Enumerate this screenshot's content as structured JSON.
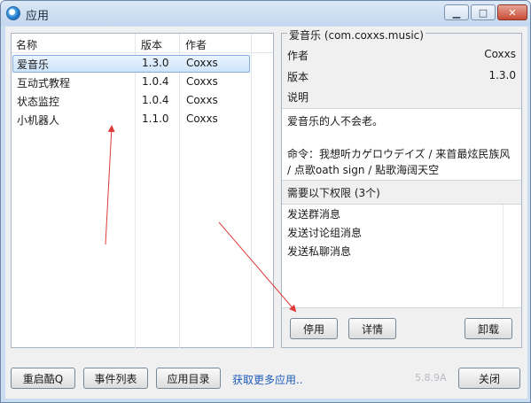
{
  "window": {
    "title": "应用",
    "icon": "app-icon",
    "controls": [
      "minimize",
      "maximize",
      "close"
    ]
  },
  "app_list": {
    "columns": [
      "名称",
      "版本",
      "作者"
    ],
    "rows": [
      {
        "name": "爱音乐",
        "version": "1.3.0",
        "author": "Coxxs",
        "selected": true
      },
      {
        "name": "互动式教程",
        "version": "1.0.4",
        "author": "Coxxs",
        "selected": false
      },
      {
        "name": "状态监控",
        "version": "1.0.4",
        "author": "Coxxs",
        "selected": false
      },
      {
        "name": "小机器人",
        "version": "1.1.0",
        "author": "Coxxs",
        "selected": false
      }
    ]
  },
  "detail": {
    "title": "爱音乐 (com.coxxs.music)",
    "author_label": "作者",
    "author_value": "Coxxs",
    "version_label": "版本",
    "version_value": "1.3.0",
    "desc_label": "说明",
    "desc_lines": [
      "爱音乐的人不会老。",
      "命令：我想听カゲロウデイズ / 来首最炫民族风",
      "/ 点歌oath sign / 點歌海阔天空"
    ],
    "permissions_header": "需要以下权限 (3个)",
    "permissions": [
      "发送群消息",
      "发送讨论组消息",
      "发送私聊消息"
    ],
    "buttons": {
      "disable": "停用",
      "details": "详情",
      "uninstall": "卸载"
    }
  },
  "footer": {
    "restart": "重启酷Q",
    "event_list": "事件列表",
    "app_dir": "应用目录",
    "more_apps_link": "获取更多应用..",
    "version": "5.8.9A",
    "close": "关闭"
  },
  "colors": {
    "accent": "#1f5bb8",
    "selection": "#cde4fb",
    "annotation_arrow": "#e03a3a"
  }
}
